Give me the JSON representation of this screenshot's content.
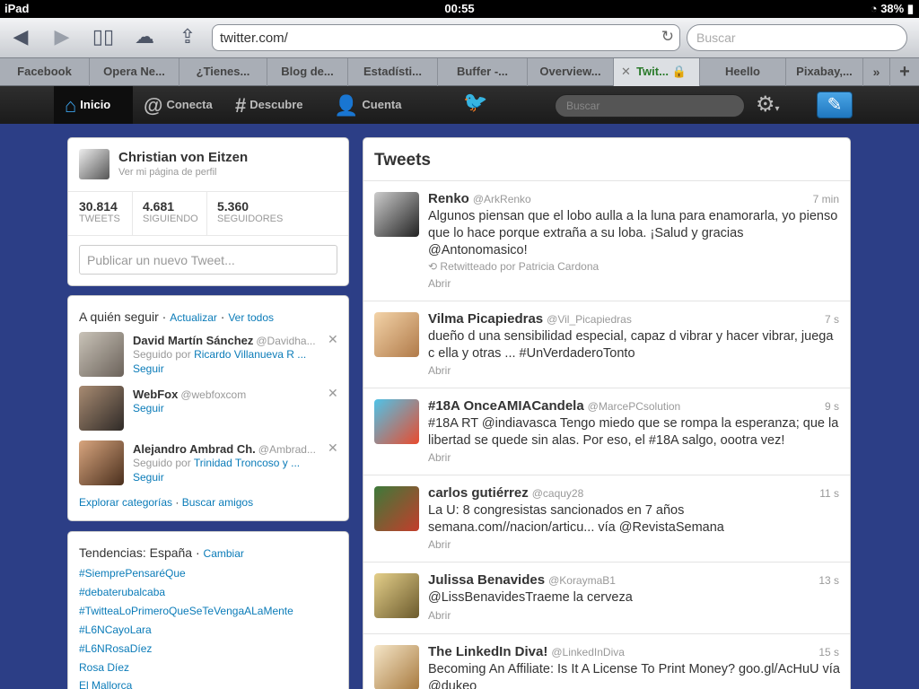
{
  "status": {
    "device": "iPad",
    "time": "00:55",
    "battery": "38%"
  },
  "browser": {
    "url": "twitter.com/",
    "search_placeholder": "Buscar",
    "tabs": [
      "Facebook",
      "Opera Ne...",
      "¿Tienes...",
      "Blog de...",
      "Estadísti...",
      "Buffer -...",
      "Overview...",
      "Twit...",
      "Heello",
      "Pixabay,..."
    ]
  },
  "nav": {
    "home": "Inicio",
    "connect": "Conecta",
    "discover": "Descubre",
    "account": "Cuenta",
    "search_placeholder": "Buscar"
  },
  "profile": {
    "name": "Christian von Eitzen",
    "profile_link": "Ver mi página de perfil",
    "stats": [
      {
        "value": "30.814",
        "label": "TWEETS"
      },
      {
        "value": "4.681",
        "label": "SIGUIENDO"
      },
      {
        "value": "5.360",
        "label": "SEGUIDORES"
      }
    ],
    "compose_placeholder": "Publicar un nuevo Tweet..."
  },
  "who_to_follow": {
    "title": "A quién seguir",
    "refresh": "Actualizar",
    "view_all": "Ver todos",
    "users": [
      {
        "name": "David Martín Sánchez",
        "handle": "@Davidha...",
        "followed_prefix": "Seguido por",
        "followed_by": "Ricardo Villanueva R ...",
        "follow": "Seguir"
      },
      {
        "name": "WebFox",
        "handle": "@webfoxcom",
        "followed_prefix": "",
        "followed_by": "",
        "follow": "Seguir"
      },
      {
        "name": "Alejandro Ambrad Ch.",
        "handle": "@Ambrad...",
        "followed_prefix": "Seguido por",
        "followed_by": "Trinidad Troncoso y ...",
        "follow": "Seguir"
      }
    ],
    "explore": "Explorar categorías",
    "find_friends": "Buscar amigos"
  },
  "trends": {
    "title": "Tendencias: España",
    "change": "Cambiar",
    "items": [
      "#SiemprePensaréQue",
      "#debaterubalcaba",
      "#TwitteaLoPrimeroQueSeTeVengaALaMente",
      "#L6NCayoLara",
      "#L6NRosaDíez",
      "Rosa Díez",
      "El Mallorca"
    ]
  },
  "tweets_header": "Tweets",
  "tweets": [
    {
      "name": "Renko",
      "handle": "@ArkRenko",
      "time": "7 min",
      "text": "Algunos piensan que el lobo aulla a la luna para enamorarla, yo pienso que lo hace porque extraña a su loba. ¡Salud y gracias @Antonomasico!",
      "retweet": "Retwitteado por Patricia Cardona",
      "open": "Abrir"
    },
    {
      "name": "Vilma Picapiedras",
      "handle": "@Vil_Picapiedras",
      "time": "7 s",
      "text": "dueño d una sensibilidad especial, capaz d vibrar y hacer vibrar, juega c ella y otras ... #UnVerdaderoTonto",
      "open": "Abrir"
    },
    {
      "name": "#18A OnceAMIACandela",
      "handle": "@MarcePCsolution",
      "time": "9 s",
      "text": "#18A RT @indiavasca Tengo miedo que se rompa la esperanza; que la libertad se quede sin alas. Por eso, el #18A salgo, oootra vez!",
      "open": "Abrir"
    },
    {
      "name": "carlos gutiérrez",
      "handle": "@caquy28",
      "time": "11 s",
      "text": "La U: 8 congresistas sancionados en 7 años semana.com//nacion/articu... vía @RevistaSemana",
      "open": "Abrir"
    },
    {
      "name": "Julissa Benavides",
      "handle": "@KoraymaB1",
      "time": "13 s",
      "text": "@LissBenavidesTraeme la cerveza",
      "open": "Abrir"
    },
    {
      "name": "The LinkedIn Diva!",
      "handle": "@LinkedInDiva",
      "time": "15 s",
      "text": "Becoming An Affiliate: Is It A License To Print Money? goo.gl/AcHuU vía @dukeo"
    }
  ]
}
